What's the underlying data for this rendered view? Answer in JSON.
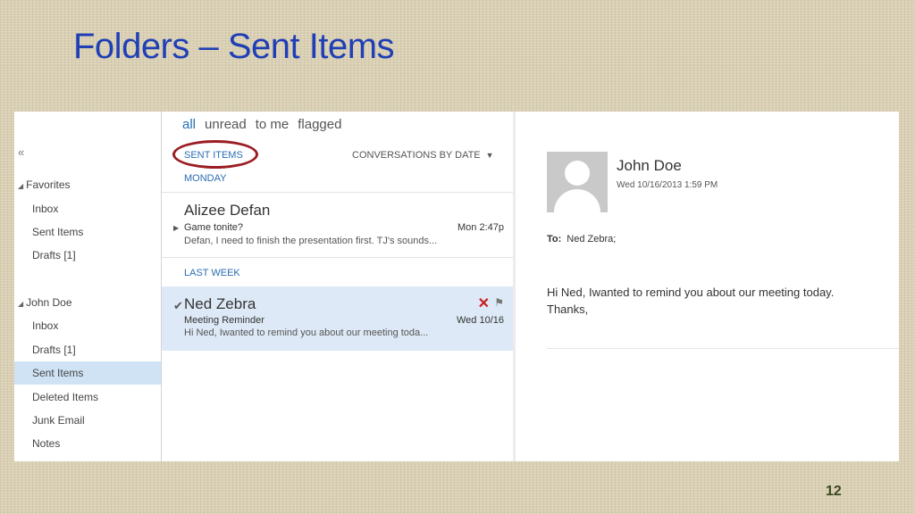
{
  "slide": {
    "title": "Folders – Sent Items",
    "page_number": "12"
  },
  "folders": {
    "collapse_label": "«",
    "favorites_label": "Favorites",
    "favorites": [
      "Inbox",
      "Sent Items",
      "Drafts [1]"
    ],
    "account_label": "John Doe",
    "account_folders": [
      "Inbox",
      "Drafts [1]",
      "Sent Items",
      "Deleted Items",
      "Junk Email",
      "Notes"
    ],
    "selected": "Sent Items"
  },
  "filters": {
    "items": [
      "all",
      "unread",
      "to me",
      "flagged"
    ],
    "active": "all"
  },
  "list": {
    "header": "SENT ITEMS",
    "sort_label": "CONVERSATIONS BY DATE",
    "groups": [
      {
        "label": "MONDAY",
        "messages": [
          {
            "sender": "Alizee Defan",
            "subject": "Game tonite?",
            "time": "Mon 2:47p",
            "preview": "Defan, I need to finish the presentation first. TJ's sounds..."
          }
        ]
      },
      {
        "label": "LAST WEEK",
        "messages": [
          {
            "sender": "Ned Zebra",
            "subject": "Meeting Reminder",
            "time": "Wed 10/16",
            "preview": "Hi Ned, Iwanted to remind you about our meeting toda..."
          }
        ]
      }
    ]
  },
  "reading": {
    "sender": "John Doe",
    "date": "Wed 10/16/2013 1:59 PM",
    "to_label": "To:",
    "to_value": "Ned Zebra;",
    "body_line1": "Hi Ned, Iwanted to remind you about our meeting today.",
    "body_line2": "Thanks,"
  },
  "colors": {
    "title_blue": "#1f3fb5",
    "link_blue": "#2a6db3",
    "selection": "#cfe3f5",
    "highlight_oval": "#9b1c22",
    "delete_red": "#c81e1e"
  }
}
